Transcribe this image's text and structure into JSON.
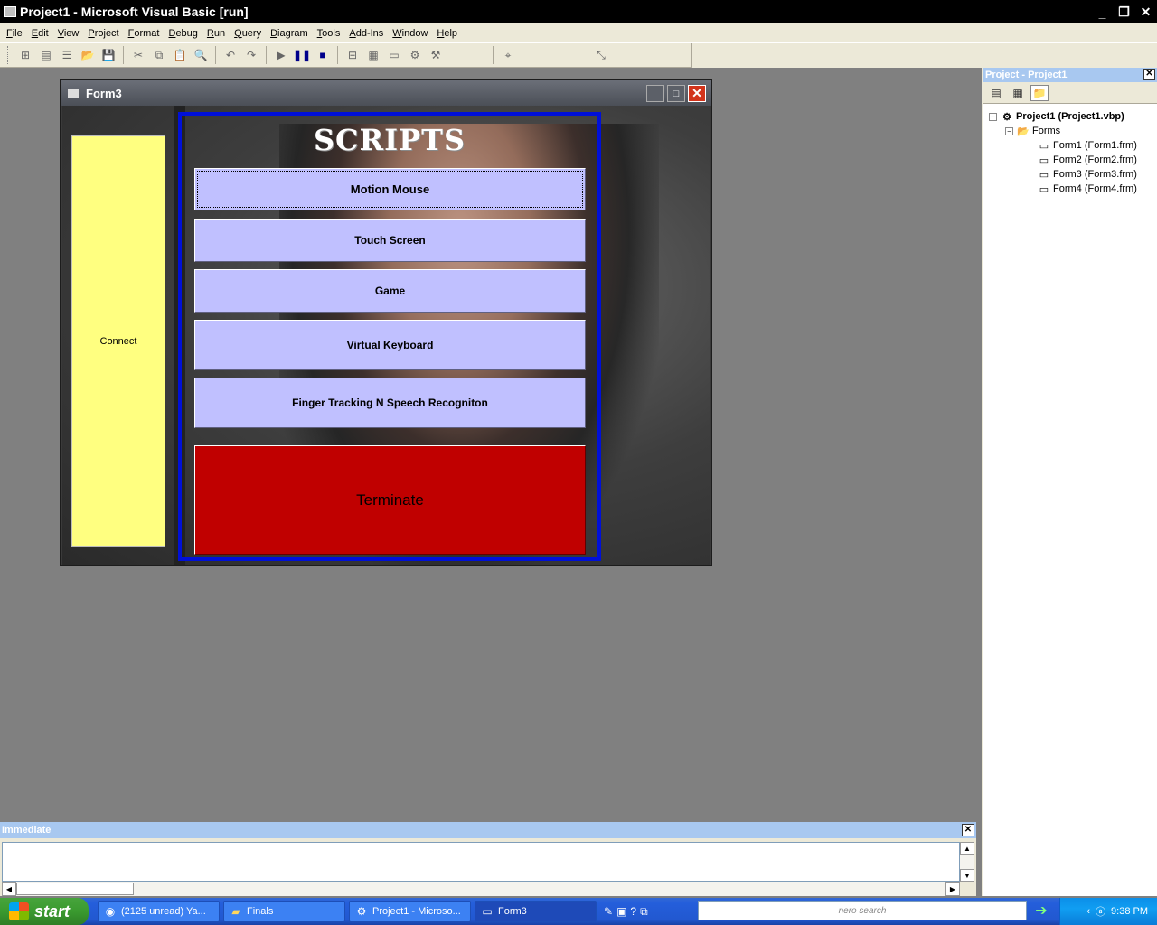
{
  "window": {
    "title": "Project1 - Microsoft Visual Basic [run]"
  },
  "menubar": {
    "items": [
      "File",
      "Edit",
      "View",
      "Project",
      "Format",
      "Debug",
      "Run",
      "Query",
      "Diagram",
      "Tools",
      "Add-Ins",
      "Window",
      "Help"
    ]
  },
  "form3": {
    "title": "Form3",
    "connect_label": "Connect",
    "scripts_heading": "SCRIPTS",
    "buttons": {
      "motion_mouse": "Motion Mouse",
      "touch_screen": "Touch Screen",
      "game": "Game",
      "virtual_keyboard": "Virtual Keyboard",
      "finger_tracking": "Finger Tracking N Speech Recogniton",
      "terminate": "Terminate"
    },
    "colors": {
      "connect_bg": "#ffff80",
      "script_btn_bg": "#c0c0ff",
      "terminate_bg": "#c00000",
      "frame_border": "#0010d8"
    }
  },
  "project_explorer": {
    "title": "Project - Project1",
    "root": "Project1 (Project1.vbp)",
    "folder": "Forms",
    "forms": [
      "Form1 (Form1.frm)",
      "Form2 (Form2.frm)",
      "Form3 (Form3.frm)",
      "Form4 (Form4.frm)"
    ]
  },
  "immediate": {
    "title": "Immediate",
    "content": ""
  },
  "taskbar": {
    "start_label": "start",
    "tasks": [
      "(2125 unread) Ya...",
      "Finals",
      "Project1 - Microso...",
      "Form3"
    ],
    "search_brand": "nero search",
    "clock": "9:38 PM"
  }
}
